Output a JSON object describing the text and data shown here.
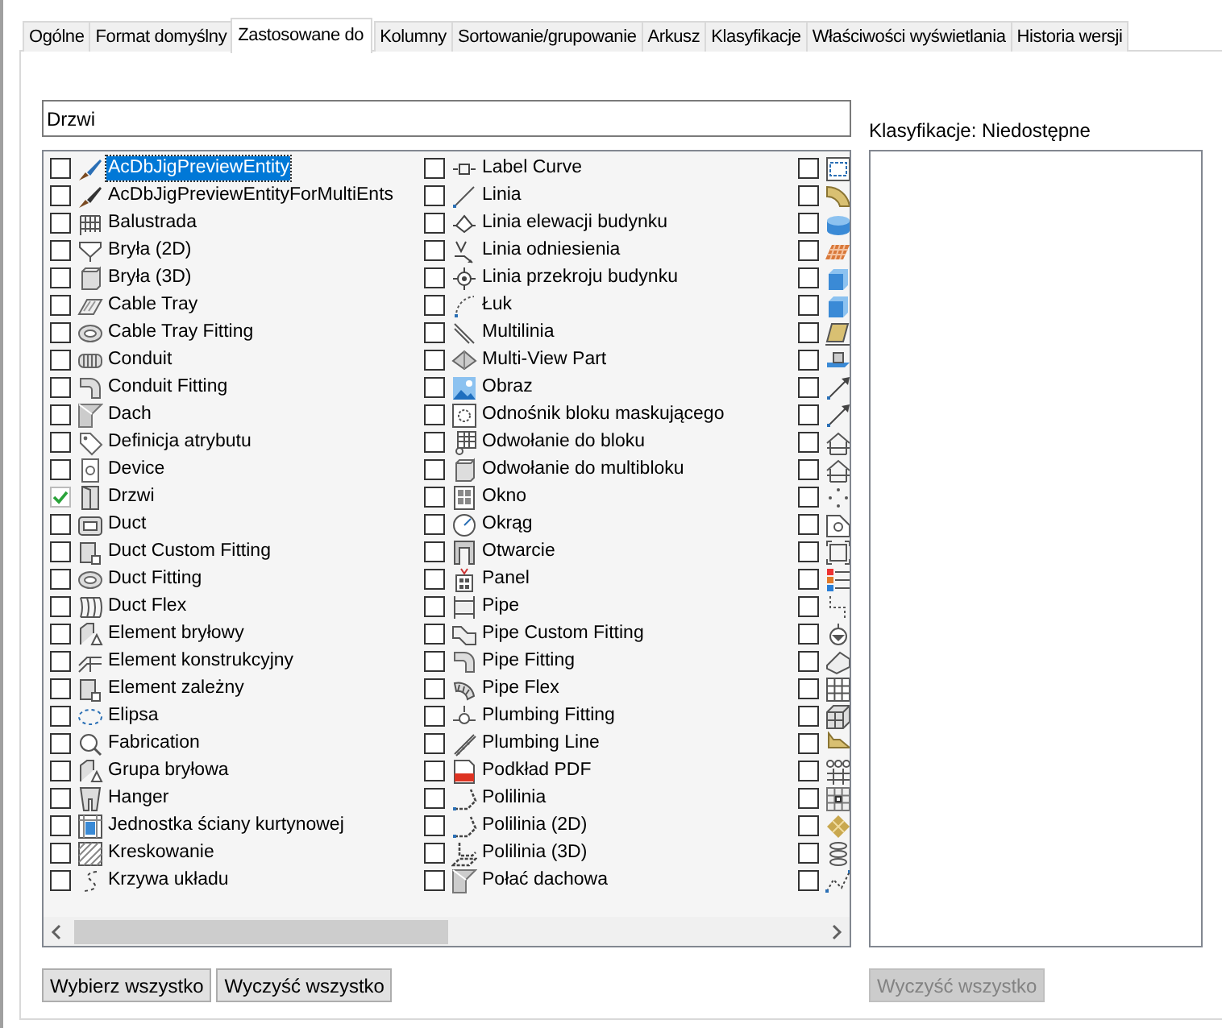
{
  "tabs": [
    {
      "label": "Ogólne",
      "selected": false
    },
    {
      "label": "Format domyślny",
      "selected": false
    },
    {
      "label": "Zastosowane do",
      "selected": true
    },
    {
      "label": "Kolumny",
      "selected": false
    },
    {
      "label": "Sortowanie/grupowanie",
      "selected": false
    },
    {
      "label": "Arkusz",
      "selected": false
    },
    {
      "label": "Klasyfikacje",
      "selected": false
    },
    {
      "label": "Właściwości wyświetlania",
      "selected": false
    },
    {
      "label": "Historia wersji",
      "selected": false
    }
  ],
  "filter_field": {
    "value": "Drzwi"
  },
  "object_list": {
    "columns": [
      {
        "items": [
          {
            "label": "AcDbJigPreviewEntity",
            "checked": false,
            "selected": true
          },
          {
            "label": "AcDbJigPreviewEntityForMultiEnts",
            "checked": false,
            "selected": false
          },
          {
            "label": "Balustrada",
            "checked": false,
            "selected": false
          },
          {
            "label": "Bryła (2D)",
            "checked": false,
            "selected": false
          },
          {
            "label": "Bryła (3D)",
            "checked": false,
            "selected": false
          },
          {
            "label": "Cable Tray",
            "checked": false,
            "selected": false
          },
          {
            "label": "Cable Tray Fitting",
            "checked": false,
            "selected": false
          },
          {
            "label": "Conduit",
            "checked": false,
            "selected": false
          },
          {
            "label": "Conduit Fitting",
            "checked": false,
            "selected": false
          },
          {
            "label": "Dach",
            "checked": false,
            "selected": false
          },
          {
            "label": "Definicja atrybutu",
            "checked": false,
            "selected": false
          },
          {
            "label": "Device",
            "checked": false,
            "selected": false
          },
          {
            "label": "Drzwi",
            "checked": true,
            "selected": false
          },
          {
            "label": "Duct",
            "checked": false,
            "selected": false
          },
          {
            "label": "Duct Custom Fitting",
            "checked": false,
            "selected": false
          },
          {
            "label": "Duct Fitting",
            "checked": false,
            "selected": false
          },
          {
            "label": "Duct Flex",
            "checked": false,
            "selected": false
          },
          {
            "label": "Element bryłowy",
            "checked": false,
            "selected": false
          },
          {
            "label": "Element konstrukcyjny",
            "checked": false,
            "selected": false
          },
          {
            "label": "Element zależny",
            "checked": false,
            "selected": false
          },
          {
            "label": "Elipsa",
            "checked": false,
            "selected": false
          },
          {
            "label": "Fabrication",
            "checked": false,
            "selected": false
          },
          {
            "label": "Grupa bryłowa",
            "checked": false,
            "selected": false
          },
          {
            "label": "Hanger",
            "checked": false,
            "selected": false
          },
          {
            "label": "Jednostka ściany kurtynowej",
            "checked": false,
            "selected": false
          },
          {
            "label": "Kreskowanie",
            "checked": false,
            "selected": false
          },
          {
            "label": "Krzywa układu",
            "checked": false,
            "selected": false
          }
        ]
      },
      {
        "items": [
          {
            "label": "Label Curve",
            "checked": false,
            "selected": false
          },
          {
            "label": "Linia",
            "checked": false,
            "selected": false
          },
          {
            "label": "Linia elewacji budynku",
            "checked": false,
            "selected": false
          },
          {
            "label": "Linia odniesienia",
            "checked": false,
            "selected": false
          },
          {
            "label": "Linia przekroju budynku",
            "checked": false,
            "selected": false
          },
          {
            "label": "Łuk",
            "checked": false,
            "selected": false
          },
          {
            "label": "Multilinia",
            "checked": false,
            "selected": false
          },
          {
            "label": "Multi-View Part",
            "checked": false,
            "selected": false
          },
          {
            "label": "Obraz",
            "checked": false,
            "selected": false
          },
          {
            "label": "Odnośnik bloku maskującego",
            "checked": false,
            "selected": false
          },
          {
            "label": "Odwołanie do bloku",
            "checked": false,
            "selected": false
          },
          {
            "label": "Odwołanie do multibloku",
            "checked": false,
            "selected": false
          },
          {
            "label": "Okno",
            "checked": false,
            "selected": false
          },
          {
            "label": "Okrąg",
            "checked": false,
            "selected": false
          },
          {
            "label": "Otwarcie",
            "checked": false,
            "selected": false
          },
          {
            "label": "Panel",
            "checked": false,
            "selected": false
          },
          {
            "label": "Pipe",
            "checked": false,
            "selected": false
          },
          {
            "label": "Pipe Custom Fitting",
            "checked": false,
            "selected": false
          },
          {
            "label": "Pipe Fitting",
            "checked": false,
            "selected": false
          },
          {
            "label": "Pipe Flex",
            "checked": false,
            "selected": false
          },
          {
            "label": "Plumbing Fitting",
            "checked": false,
            "selected": false
          },
          {
            "label": "Plumbing Line",
            "checked": false,
            "selected": false
          },
          {
            "label": "Podkład PDF",
            "checked": false,
            "selected": false
          },
          {
            "label": "Polilinia",
            "checked": false,
            "selected": false
          },
          {
            "label": "Polilinia (2D)",
            "checked": false,
            "selected": false
          },
          {
            "label": "Polilinia (3D)",
            "checked": false,
            "selected": false
          },
          {
            "label": "Połać dachowa",
            "checked": false,
            "selected": false
          }
        ]
      },
      {
        "items": [
          {
            "checked": false
          },
          {
            "checked": false
          },
          {
            "checked": false
          },
          {
            "checked": false
          },
          {
            "checked": false
          },
          {
            "checked": false
          },
          {
            "checked": false
          },
          {
            "checked": false
          },
          {
            "checked": false
          },
          {
            "checked": false
          },
          {
            "checked": false
          },
          {
            "checked": false
          },
          {
            "checked": false
          },
          {
            "checked": false
          },
          {
            "checked": false
          },
          {
            "checked": false
          },
          {
            "checked": false
          },
          {
            "checked": false
          },
          {
            "checked": false
          },
          {
            "checked": false
          },
          {
            "checked": false
          },
          {
            "checked": false
          },
          {
            "checked": false
          },
          {
            "checked": false
          },
          {
            "checked": false
          },
          {
            "checked": false
          },
          {
            "checked": false
          }
        ]
      }
    ]
  },
  "buttons": [
    {
      "label": "Wybierz wszystko",
      "disabled": false
    },
    {
      "label": "Wyczyść wszystko",
      "disabled": false
    }
  ],
  "classification": {
    "label": "Klasyfikacje: Niedostępne",
    "buttons": [
      {
        "label": "Wyczyść wszystko",
        "disabled": true
      }
    ]
  }
}
